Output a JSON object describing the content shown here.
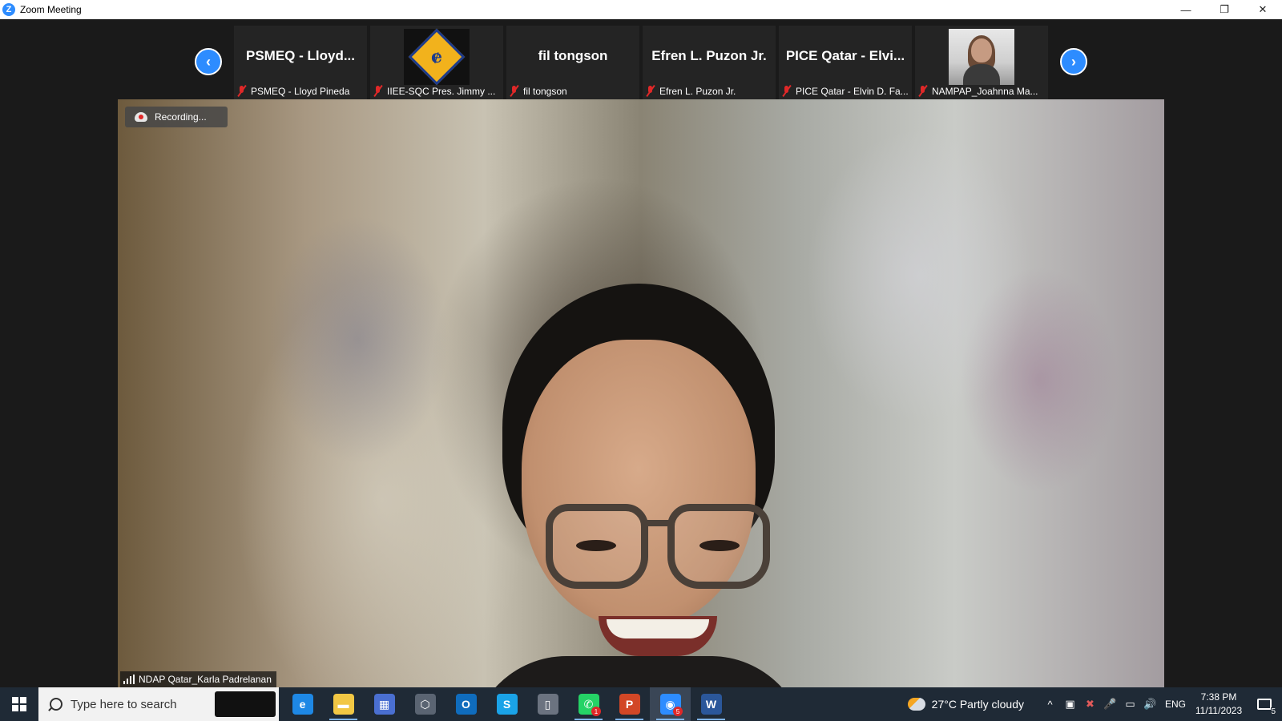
{
  "window": {
    "app_icon_letter": "Z",
    "title": "Zoom Meeting",
    "minimize": "—",
    "restore": "❐",
    "close": "✕"
  },
  "strip": {
    "prev_arrow": "‹",
    "next_arrow": "›",
    "tiles": [
      {
        "big_name": "PSMEQ - Lloyd...",
        "caption": "PSMEQ - Lloyd Pineda",
        "muted": true
      },
      {
        "big_name": "",
        "caption": "IIEE-SQC Pres. Jimmy ...",
        "muted": true,
        "logo_glyph": "ɇ"
      },
      {
        "big_name": "fil tongson",
        "caption": "fil tongson",
        "muted": true
      },
      {
        "big_name": "Efren L. Puzon Jr.",
        "caption": "Efren L. Puzon Jr.",
        "muted": true
      },
      {
        "big_name": "PICE Qatar - Elvi...",
        "caption": "PICE Qatar - Elvin D. Fa...",
        "muted": true
      },
      {
        "big_name": "",
        "caption": "NAMPAP_Joahnna Ma...",
        "muted": true
      }
    ]
  },
  "main_video": {
    "recording_label": "Recording...",
    "speaker_name": "NDAP Qatar_Karla Padrelanan"
  },
  "taskbar": {
    "search_placeholder": "Type here to search",
    "apps": [
      {
        "name": "edge",
        "glyph": "e",
        "color": "#1e88e5",
        "active": false
      },
      {
        "name": "file-explorer",
        "glyph": "▬",
        "color": "#f2c744",
        "active": true
      },
      {
        "name": "store",
        "glyph": "▦",
        "color": "#4a6fd1",
        "active": false
      },
      {
        "name": "app-3d",
        "glyph": "⬡",
        "color": "#5a6472",
        "active": false
      },
      {
        "name": "outlook",
        "glyph": "O",
        "color": "#0f6cbd",
        "active": false
      },
      {
        "name": "skype",
        "glyph": "S",
        "color": "#1aa3e8",
        "active": false
      },
      {
        "name": "usb",
        "glyph": "▯",
        "color": "#6b7380",
        "active": false
      },
      {
        "name": "whatsapp",
        "glyph": "✆",
        "color": "#25d366",
        "active": true,
        "badge": "1"
      },
      {
        "name": "powerpoint",
        "glyph": "P",
        "color": "#d24726",
        "active": true
      },
      {
        "name": "zoom",
        "glyph": "◉",
        "color": "#2d8cff",
        "active": true,
        "badge": "5",
        "highlight": true
      },
      {
        "name": "word",
        "glyph": "W",
        "color": "#2b579a",
        "active": true
      }
    ],
    "weather_text": "27°C  Partly cloudy",
    "tray_icons": [
      "^",
      "▣",
      "✖",
      "🎤",
      "▭",
      "🔊"
    ],
    "language": "ENG",
    "time": "7:38 PM",
    "date": "11/11/2023",
    "notification_count": "5"
  }
}
